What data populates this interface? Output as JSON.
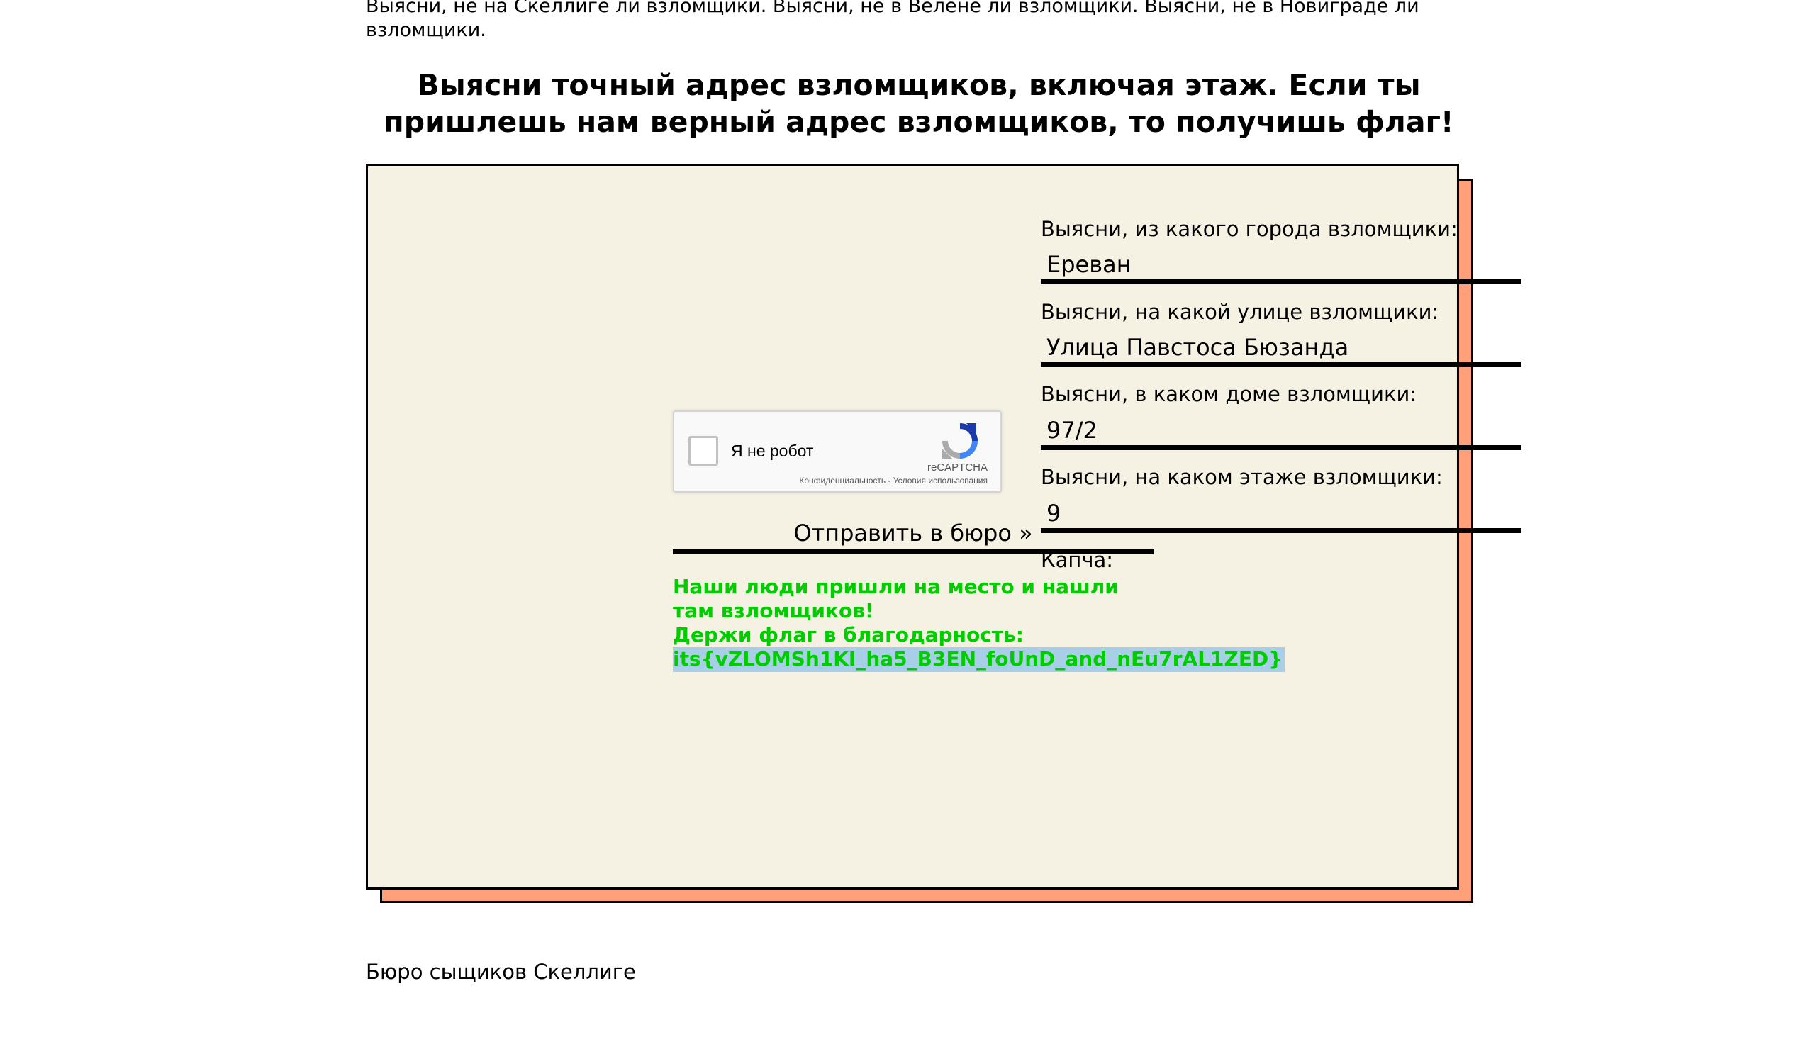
{
  "intro_text": "Выясни, не на Скеллиге ли взломщики. Выясни, не в Велене ли взломщики. Выясни, не в Новиграде ли взломщики.",
  "headline": "Выясни точный адрес взломщиков, включая этаж. Если ты пришлешь нам верный адрес взломщиков, то получишь флаг!",
  "form": {
    "city": {
      "label": "Выясни, из какого города взломщики:",
      "value": "Ереван"
    },
    "street": {
      "label": "Выясни, на какой улице взломщики:",
      "value": "Улица Павстоса Бюзанда"
    },
    "house": {
      "label": "Выясни, в каком доме взломщики:",
      "value": "97/2"
    },
    "floor": {
      "label": "Выясни, на каком этаже взломщики:",
      "value": "9"
    },
    "captcha_label": "Капча:",
    "submit_label": "Отправить в бюро »"
  },
  "captcha": {
    "checkbox_label": "Я не робот",
    "brand": "reCAPTCHA",
    "privacy_link": "Конфиденциальность",
    "separator": " - ",
    "terms_link": "Условия использования",
    "checked": false
  },
  "result": {
    "line1": "Наши люди пришли на место и нашли",
    "line2": "там взломщиков!",
    "line3": "Держи флаг в благодарность:",
    "flag": "its{vZLOMSh1KI_ha5_B3EN_foUnD_and_nEu7rAL1ZED}",
    "color": "#00cc00"
  },
  "footer_text": "Бюро сыщиков Скеллиге",
  "colors": {
    "card_background": "#f5f2e3",
    "card_shadow": "#ffa07a",
    "flag_highlight": "#a9cfe8"
  }
}
